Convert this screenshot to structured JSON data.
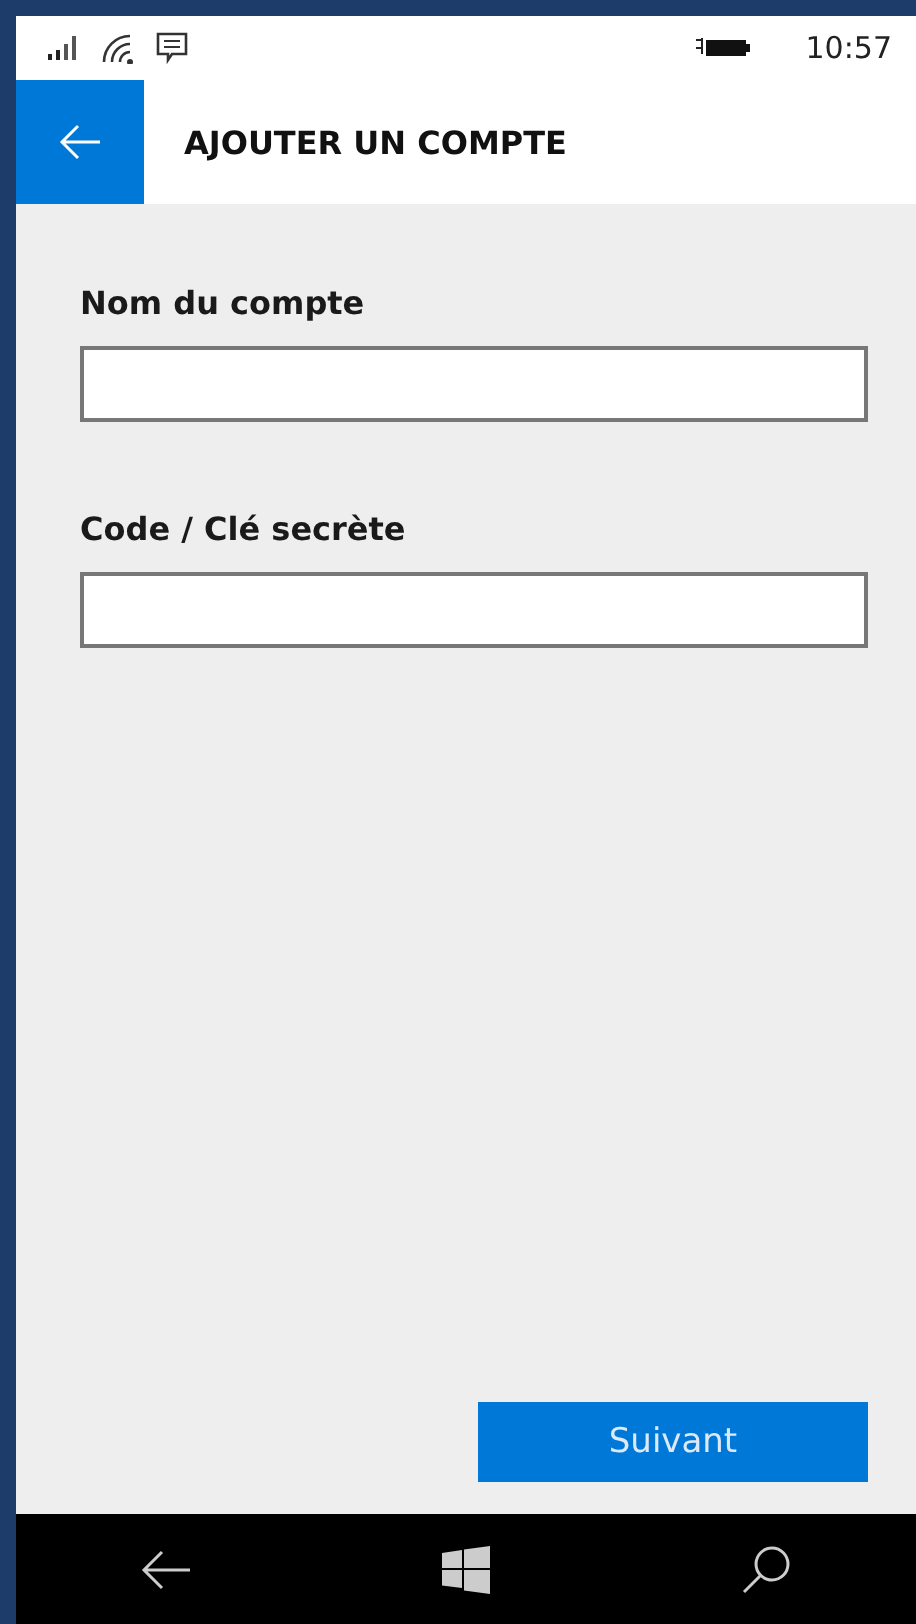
{
  "status_bar": {
    "time": "10:57"
  },
  "header": {
    "title": "AJOUTER UN COMPTE"
  },
  "fields": [
    {
      "label": "Nom du compte"
    },
    {
      "label": "Code / Clé secrète"
    }
  ],
  "button": {
    "label": "Suivant"
  }
}
